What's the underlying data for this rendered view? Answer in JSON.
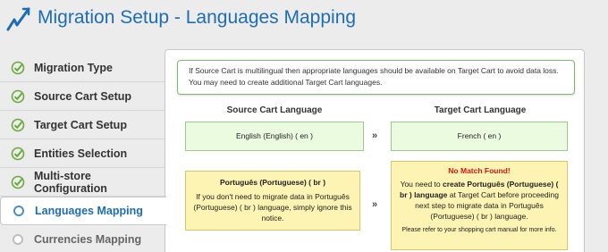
{
  "header": {
    "title": "Migration Setup - Languages Mapping",
    "logo_icon": "migration-arrow-icon"
  },
  "sidebar": {
    "items": [
      {
        "label": "Migration Type",
        "state": "done"
      },
      {
        "label": "Source Cart Setup",
        "state": "done"
      },
      {
        "label": "Target Cart Setup",
        "state": "done"
      },
      {
        "label": "Entities Selection",
        "state": "done"
      },
      {
        "label": "Multi-store Configuration",
        "state": "done"
      },
      {
        "label": "Languages Mapping",
        "state": "active"
      },
      {
        "label": "Currencies Mapping",
        "state": "pending"
      }
    ]
  },
  "notice": {
    "line1": "If Source Cart is multilingual then appropriate languages should be available on Target Cart to avoid data loss.",
    "line2": "You may need to create additional Target Cart languages."
  },
  "mapping": {
    "source_heading": "Source Cart Language",
    "target_heading": "Target Cart Language",
    "arrow": "»",
    "rows": [
      {
        "source": "English (English) ( en )",
        "target": "French ( en )"
      },
      {
        "source_title": "Português (Portuguese) ( br )",
        "source_note": "If you don't need to migrate data in Português (Portuguese) ( br ) language, simply ignore this notice.",
        "target_status": "No Match Found!",
        "target_text_pre": "You need to ",
        "target_text_bold": "create Português (Portuguese) ( br ) language",
        "target_text_post": " at Target Cart before proceeding next step to migrate data in Português (Portuguese) ( br ) language.",
        "target_small": "Please refer to your shopping cart manual for more info."
      }
    ]
  },
  "colors": {
    "title_blue": "#1d6db3",
    "check_green": "#6aaa3a",
    "warning_red": "#d21818"
  }
}
